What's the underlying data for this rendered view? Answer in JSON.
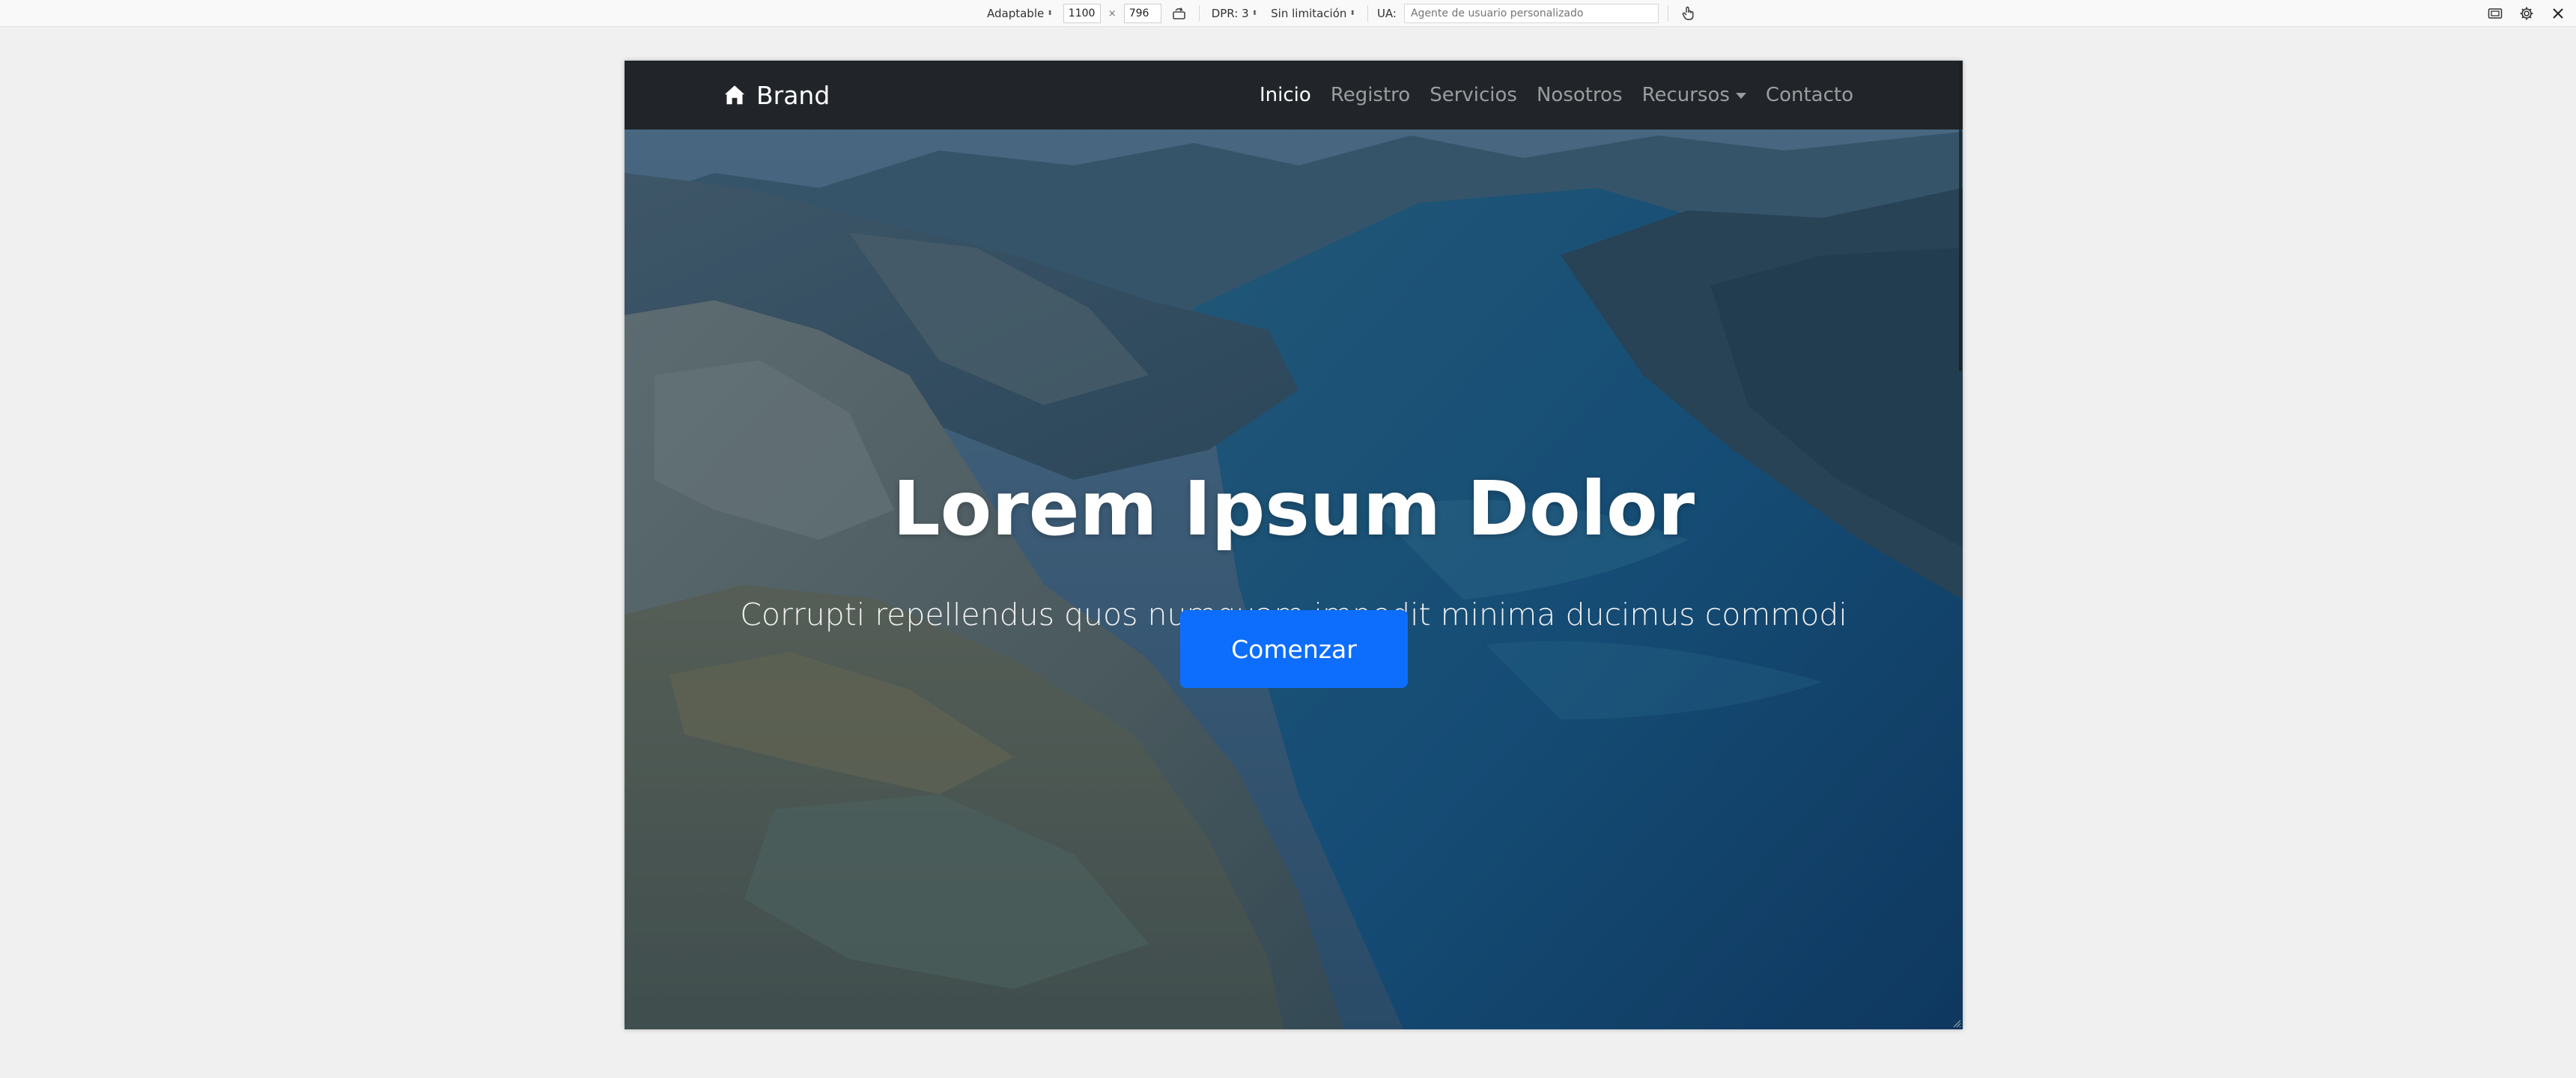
{
  "toolbar": {
    "device_label": "Adaptable",
    "width_value": "1100",
    "times": "×",
    "height_value": "796",
    "dpr_label": "DPR: 3",
    "throttle_label": "Sin limitación",
    "ua_label": "UA:",
    "ua_placeholder": "Agente de usuario personalizado",
    "icons": [
      "rotate-icon",
      "touch-icon",
      "screenshot-icon",
      "settings-icon",
      "close-icon"
    ]
  },
  "page": {
    "brand": "Brand",
    "brand_icon": "home-icon",
    "nav": [
      {
        "label": "Inicio",
        "active": true
      },
      {
        "label": "Registro",
        "active": false
      },
      {
        "label": "Servicios",
        "active": false
      },
      {
        "label": "Nosotros",
        "active": false
      },
      {
        "label": "Recursos",
        "active": false,
        "dropdown": true
      },
      {
        "label": "Contacto",
        "active": false
      }
    ],
    "hero": {
      "title": "Lorem Ipsum Dolor",
      "subtitle": "Corrupti repellendus quos numquam impedit minima ducimus commodi",
      "button": "Comenzar"
    }
  },
  "colors": {
    "navbar_bg": "#212529",
    "button_bg": "#0d6efd",
    "toolbar_bg": "#f9f9fa",
    "page_bg": "#f0f0f0"
  }
}
